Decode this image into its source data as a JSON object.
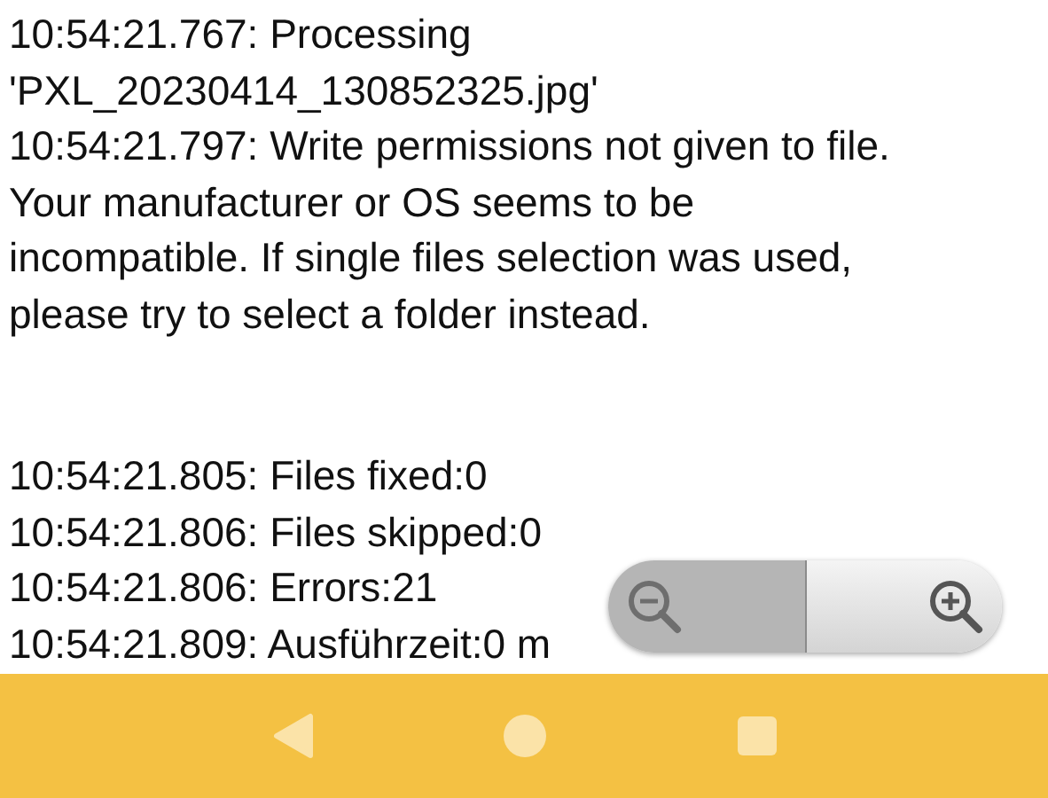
{
  "log": [
    {
      "lines": [
        "10:54:21.767: Processing",
        "'PXL_20230414_130852325.jpg'"
      ]
    },
    {
      "lines": [
        "10:54:21.797: Write permissions not given to file.",
        "Your manufacturer or OS seems to be",
        "incompatible. If single files selection was used,",
        "please try to select a folder instead."
      ]
    }
  ],
  "summary": [
    "10:54:21.805: Files fixed:0",
    "10:54:21.806: Files skipped:0",
    "10:54:21.806: Errors:21",
    "10:54:21.809: Ausführzeit:0 m"
  ],
  "zoom_control": {
    "zoom_out_disabled": true
  }
}
